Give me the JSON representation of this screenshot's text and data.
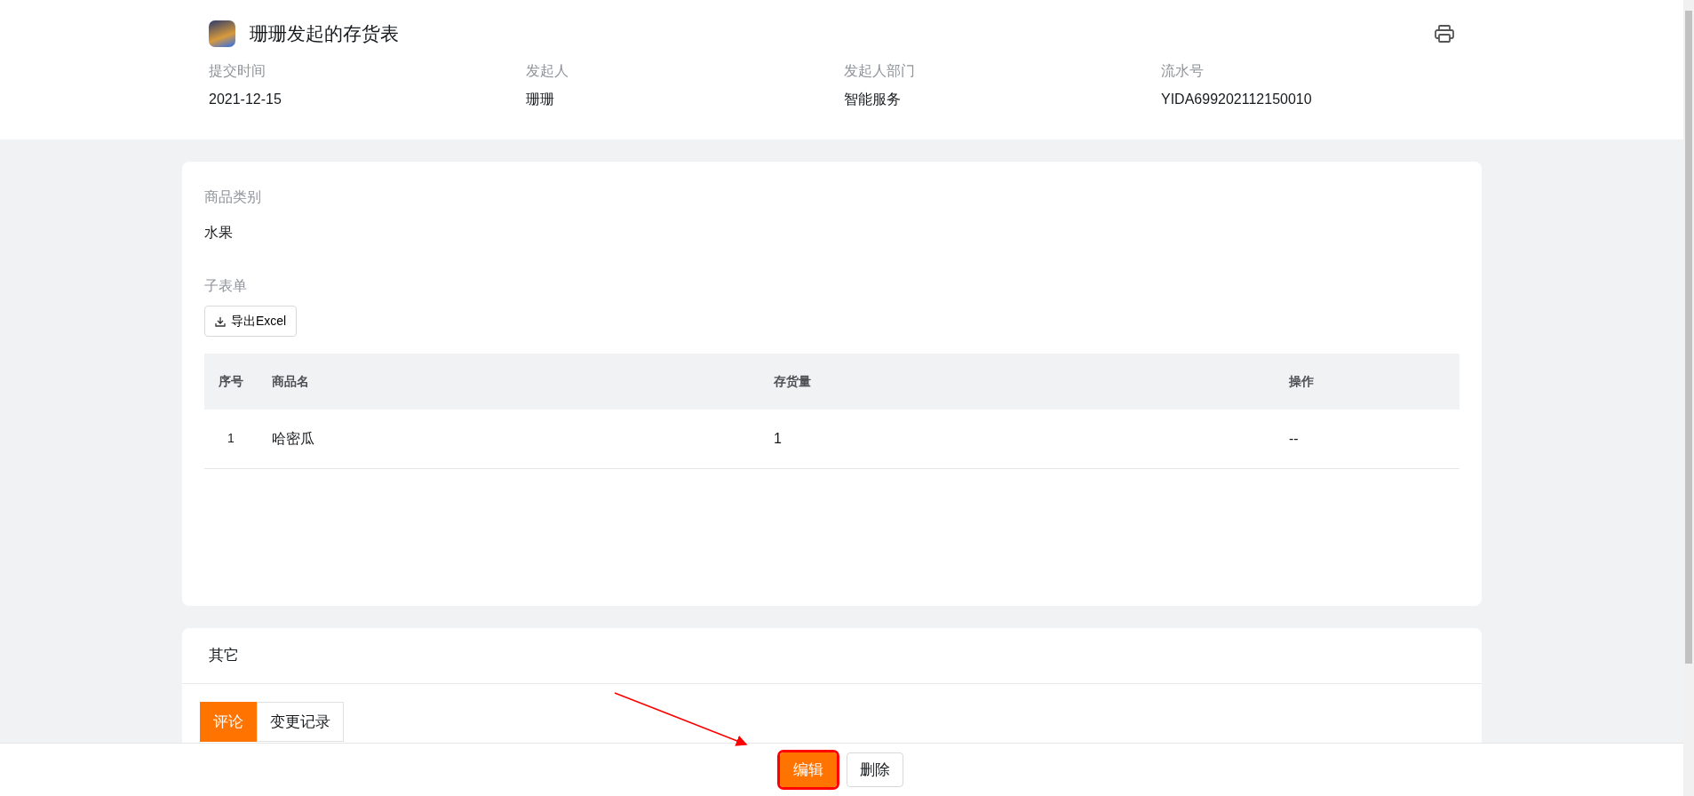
{
  "header": {
    "title": "珊珊发起的存货表",
    "meta": [
      {
        "label": "提交时间",
        "value": "2021-12-15"
      },
      {
        "label": "发起人",
        "value": "珊珊"
      },
      {
        "label": "发起人部门",
        "value": "智能服务"
      },
      {
        "label": "流水号",
        "value": "YIDA699202112150010"
      }
    ]
  },
  "form": {
    "fields": [
      {
        "label": "商品类别",
        "value": "水果"
      }
    ],
    "subform": {
      "label": "子表单",
      "export_button": "导出Excel",
      "columns": [
        "序号",
        "商品名",
        "存货量",
        "操作"
      ],
      "rows": [
        [
          "1",
          "哈密瓜",
          "1",
          "--"
        ]
      ]
    }
  },
  "other": {
    "title": "其它",
    "tabs": [
      {
        "label": "评论",
        "selected": true
      },
      {
        "label": "变更记录",
        "selected": false
      }
    ]
  },
  "footer": {
    "buttons": [
      {
        "label": "编辑",
        "primary": true,
        "highlighted": true
      },
      {
        "label": "删除",
        "primary": false,
        "highlighted": false
      }
    ]
  }
}
